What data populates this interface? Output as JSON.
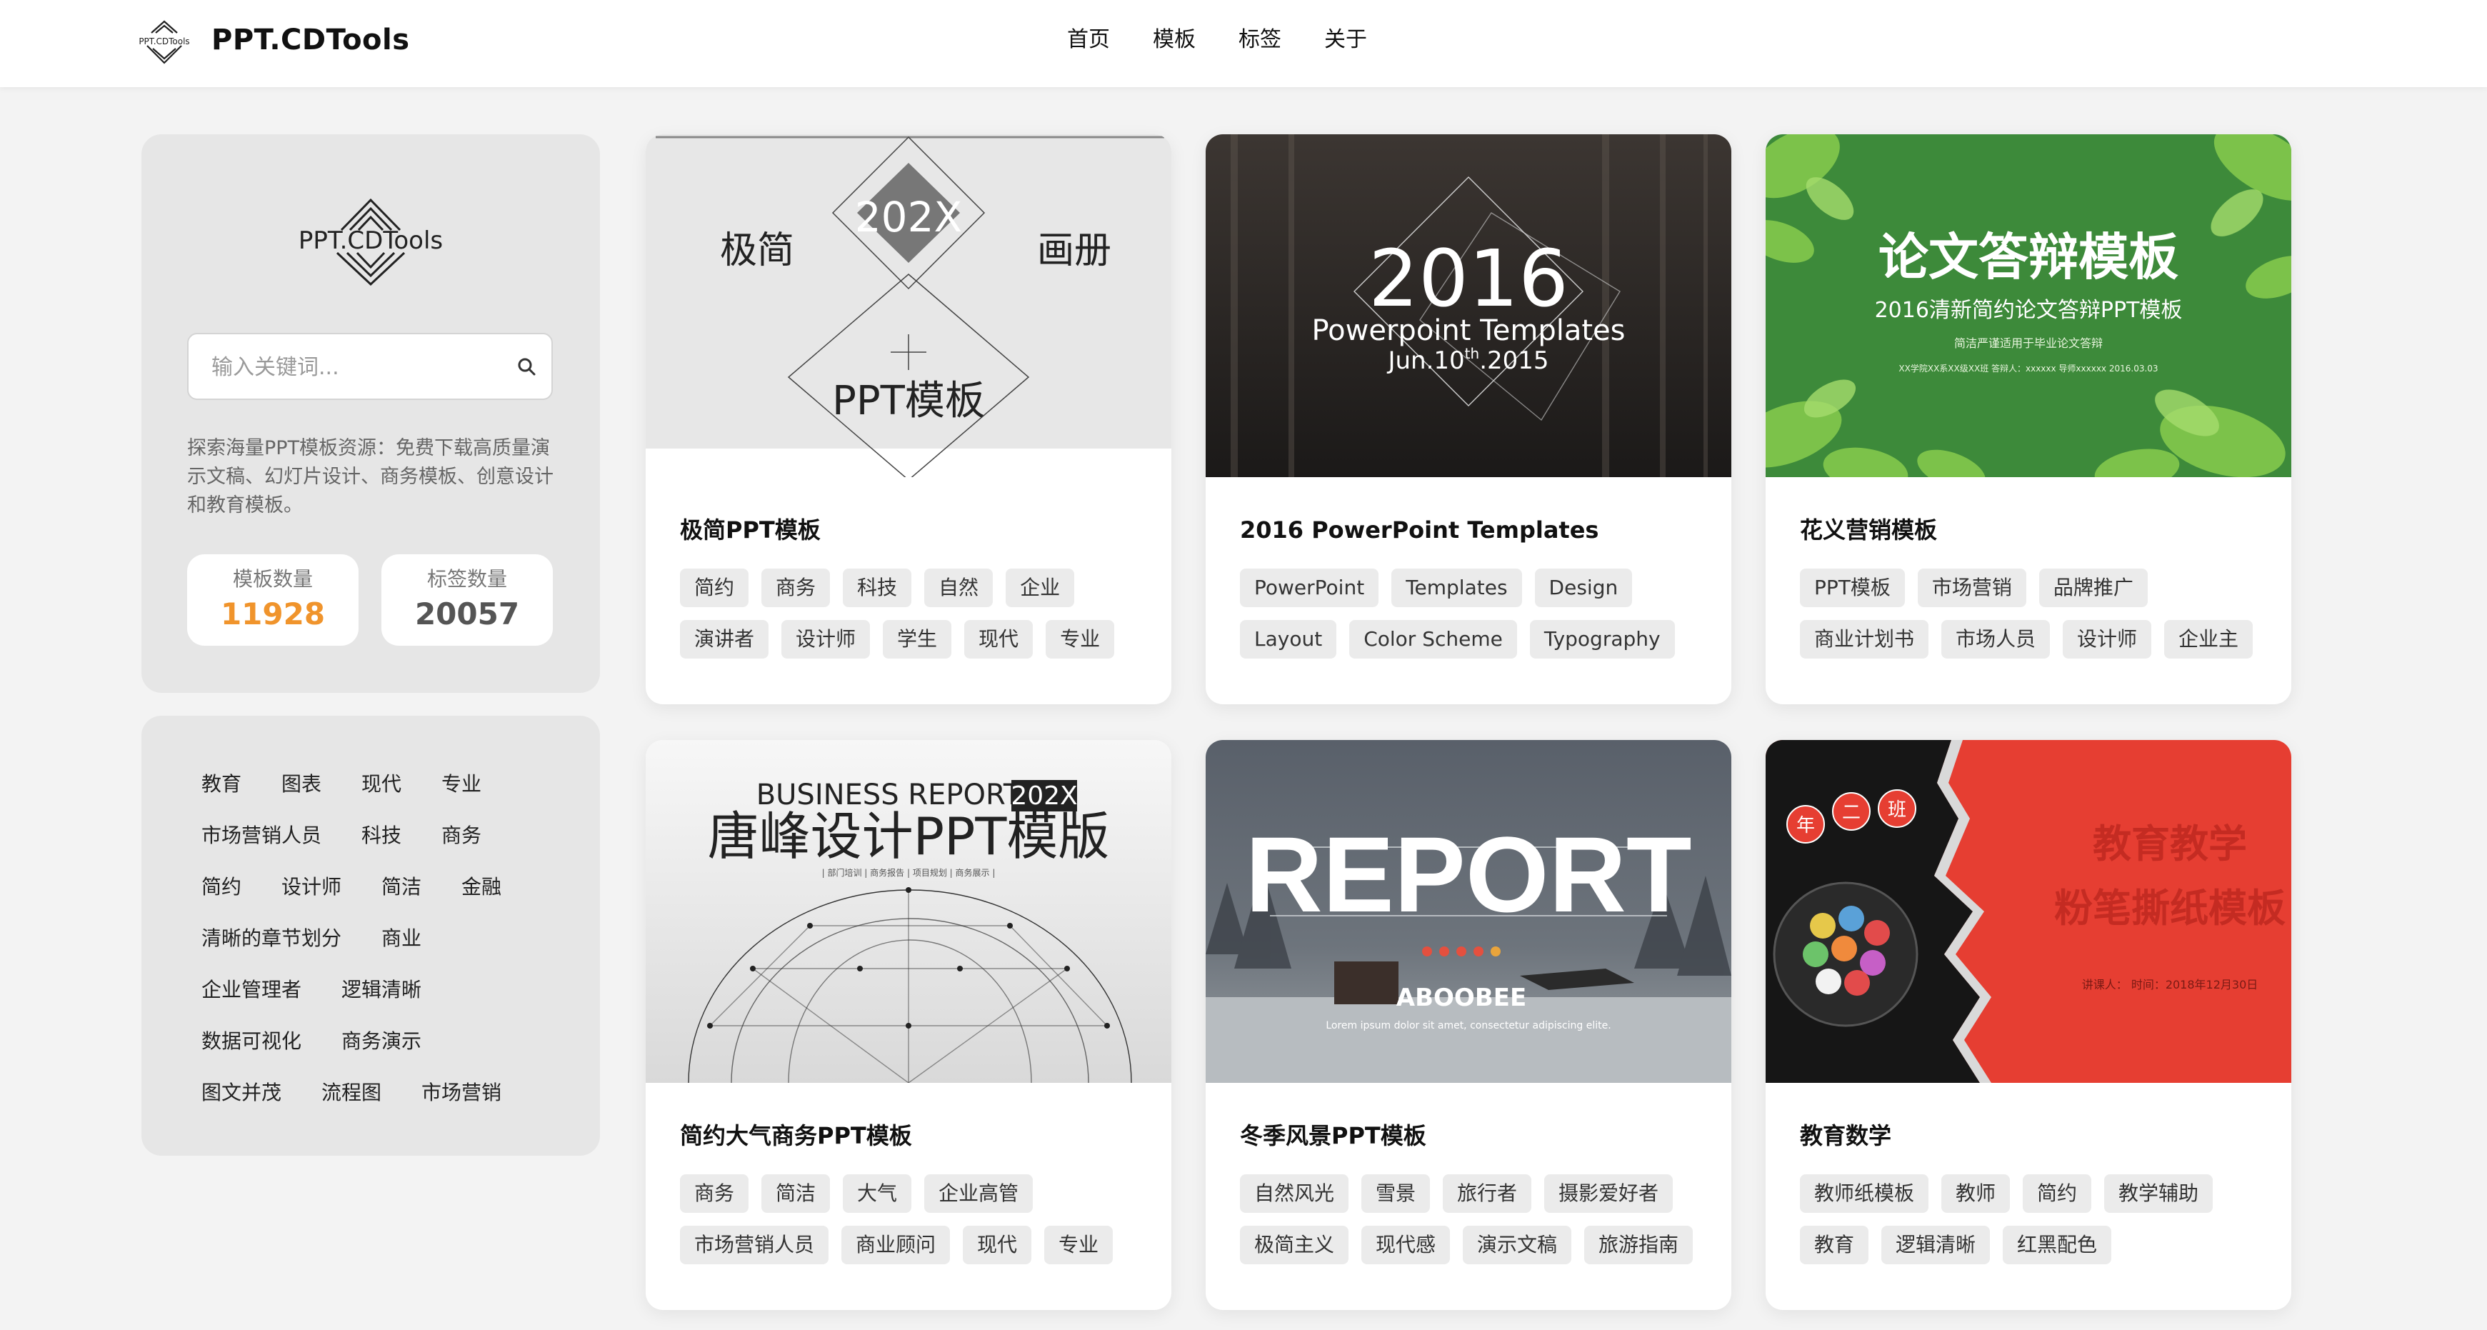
{
  "header": {
    "logo_text": "PPT.CDTools",
    "brand": "PPT.CDTools",
    "nav": [
      "首页",
      "模板",
      "标签",
      "关于"
    ]
  },
  "sidebar": {
    "logo_text": "PPT.CDTools",
    "search_placeholder": "输入关键词...",
    "description": "探索海量PPT模板资源：免费下载高质量演示文稿、幻灯片设计、商务模板、创意设计和教育模板。",
    "stats": [
      {
        "label": "模板数量",
        "value": "11928",
        "color": "#f0942c"
      },
      {
        "label": "标签数量",
        "value": "20057",
        "color": "#555555"
      }
    ],
    "tag_rows": [
      [
        "教育",
        "图表",
        "现代",
        "专业"
      ],
      [
        "市场营销人员",
        "科技",
        "商务"
      ],
      [
        "简约",
        "设计师",
        "简洁",
        "金融"
      ],
      [
        "清晰的章节划分",
        "商业"
      ],
      [
        "企业管理者",
        "逻辑清晰"
      ],
      [
        "数据可视化",
        "商务演示"
      ],
      [
        "图文并茂",
        "流程图",
        "市场营销"
      ]
    ]
  },
  "cards": [
    {
      "title": "极简PPT模板",
      "tag_rows": [
        [
          "简约",
          "商务",
          "科技",
          "自然",
          "企业"
        ],
        [
          "演讲者",
          "设计师",
          "学生",
          "现代",
          "专业"
        ]
      ],
      "thumb": {
        "left": "极简",
        "center": "202X",
        "right": "画册",
        "bottom": "PPT模板"
      }
    },
    {
      "title": "2016 PowerPoint Templates",
      "tag_rows": [
        [
          "PowerPoint",
          "Templates",
          "Design"
        ],
        [
          "Layout",
          "Color Scheme",
          "Typography"
        ]
      ],
      "thumb": {
        "year": "2016",
        "line1": "Powerpoint  Templates",
        "date_pre": "Jun.10",
        "date_sup": "th",
        "date_post": ".2015"
      }
    },
    {
      "title": "花义营销模板",
      "tag_rows": [
        [
          "PPT模板",
          "市场营销",
          "品牌推广"
        ],
        [
          "商业计划书",
          "市场人员",
          "设计师",
          "企业主"
        ]
      ],
      "thumb": {
        "heading": "论文答辩模板",
        "sub": "2016清新简约论文答辩PPT模板",
        "small": "简洁严谨适用于毕业论文答辩",
        "info": "XX学院XX系XX级XX班    答辩人：xxxxxx  导师xxxxxx  2016.03.03"
      }
    },
    {
      "title": "简约大气商务PPT模板",
      "tag_rows": [
        [
          "商务",
          "简洁",
          "大气",
          "企业高管"
        ],
        [
          "市场营销人员",
          "商业顾问",
          "现代",
          "专业"
        ]
      ],
      "thumb": {
        "top": "BUSINESS REPORT",
        "badge": "202X",
        "heading": "唐峰设计PPT模版",
        "sub": "| 部门培训 | 商务报告 | 项目规划 | 商务展示 |"
      }
    },
    {
      "title": "冬季风景PPT模板",
      "tag_rows": [
        [
          "自然风光",
          "雪景",
          "旅行者",
          "摄影爱好者"
        ],
        [
          "极简主义",
          "现代感",
          "演示文稿",
          "旅游指南"
        ]
      ],
      "thumb": {
        "heading": "REPORT",
        "name": "ABOOBEE",
        "lorem": "Lorem ipsum dolor sit amet, consectetur adipiscing elite."
      }
    },
    {
      "title": "教育数学",
      "tag_rows": [
        [
          "教师纸模板",
          "教师",
          "简约",
          "教学辅助"
        ],
        [
          "教育",
          "逻辑清晰",
          "红黑配色"
        ]
      ],
      "thumb": {
        "heading1": "教育教学",
        "heading2": "粉笔撕纸模板",
        "info": "讲课人：    时间：2018年12月30日",
        "badge1": "年",
        "badge2": "二",
        "badge3": "班"
      }
    }
  ]
}
